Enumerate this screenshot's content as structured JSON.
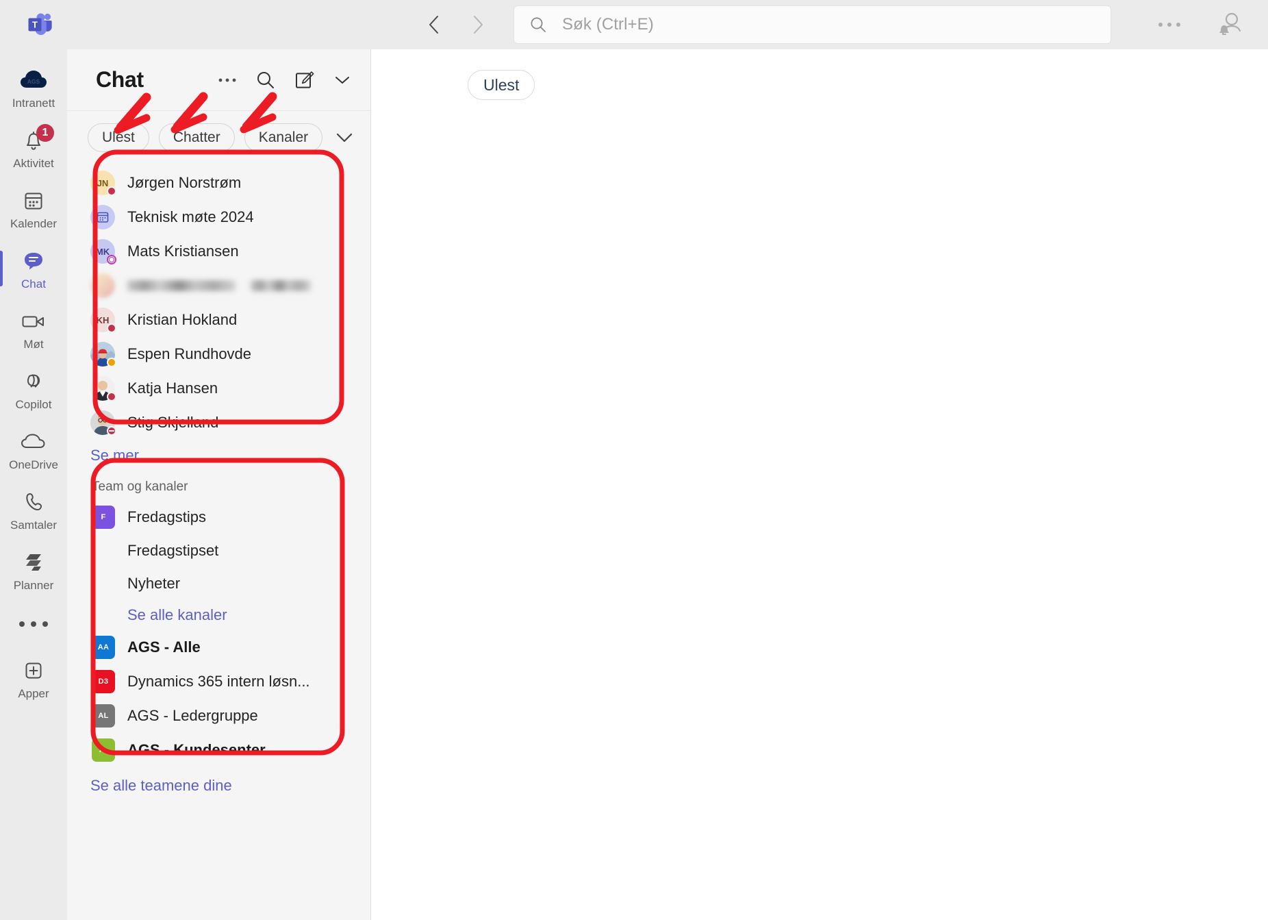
{
  "app": {
    "logo": "teams-logo"
  },
  "topbar": {
    "back_icon": "chevron-left-icon",
    "forward_icon": "chevron-right-icon",
    "search_icon": "search-icon",
    "search_placeholder": "Søk (Ctrl+E)",
    "more_icon": "ellipsis-icon",
    "account_icon": "account-bell-icon"
  },
  "rail": {
    "items": [
      {
        "label": "Intranett",
        "icon": "cloud-ags-icon",
        "badge": "",
        "active": false
      },
      {
        "label": "Aktivitet",
        "icon": "bell-icon",
        "badge": "1",
        "active": false
      },
      {
        "label": "Kalender",
        "icon": "calendar-icon",
        "badge": "",
        "active": false
      },
      {
        "label": "Chat",
        "icon": "chat-bubble-icon",
        "badge": "",
        "active": true
      },
      {
        "label": "Møt",
        "icon": "video-camera-icon",
        "badge": "",
        "active": false
      },
      {
        "label": "Copilot",
        "icon": "copilot-icon",
        "badge": "",
        "active": false
      },
      {
        "label": "OneDrive",
        "icon": "cloud-icon",
        "badge": "",
        "active": false
      },
      {
        "label": "Samtaler",
        "icon": "phone-icon",
        "badge": "",
        "active": false
      },
      {
        "label": "Planner",
        "icon": "planner-icon",
        "badge": "",
        "active": false
      }
    ],
    "more_icon": "ellipsis-icon",
    "apps": {
      "label": "Apper",
      "icon": "plus-square-icon"
    }
  },
  "pane": {
    "title": "Chat",
    "tools": [
      {
        "icon": "ellipsis-icon",
        "name": "more-options"
      },
      {
        "icon": "search-icon",
        "name": "search-chat"
      },
      {
        "icon": "compose-icon",
        "name": "new-chat"
      },
      {
        "icon": "chevron-down-icon",
        "name": "new-chat-dropdown"
      }
    ],
    "filters": [
      "Ulest",
      "Chatter",
      "Kanaler"
    ],
    "filter_expand_icon": "chevron-down-icon",
    "chats": [
      {
        "name": "Jørgen Norstrøm",
        "avatar_type": "initials",
        "initials": "JN",
        "avatar_bg": "#f8e3b0",
        "avatar_fg": "#7a5a10",
        "presence": "busy"
      },
      {
        "name": "Teknisk møte 2024",
        "avatar_type": "meeting",
        "initials": "",
        "avatar_bg": "#c5cbf5",
        "avatar_fg": "#4a4fc4",
        "presence": ""
      },
      {
        "name": "Mats Kristiansen",
        "avatar_type": "initials",
        "initials": "MK",
        "avatar_bg": "#c5c8f0",
        "avatar_fg": "#3b3b8f",
        "presence": "oof"
      },
      {
        "name": "",
        "avatar_type": "blurred",
        "initials": "",
        "avatar_bg": "",
        "avatar_fg": "",
        "presence": ""
      },
      {
        "name": "Kristian Hokland",
        "avatar_type": "initials",
        "initials": "KH",
        "avatar_bg": "#f2dcdc",
        "avatar_fg": "#6b3a3a",
        "presence": "busy"
      },
      {
        "name": "Espen Rundhovde",
        "avatar_type": "photo",
        "initials": "",
        "avatar_bg": "#8aa8c8",
        "avatar_fg": "",
        "presence": "away"
      },
      {
        "name": "Katja Hansen",
        "avatar_type": "photo",
        "initials": "",
        "avatar_bg": "#dcdcdc",
        "avatar_fg": "",
        "presence": "busy"
      },
      {
        "name": "Stig Skjelland",
        "avatar_type": "photo",
        "initials": "",
        "avatar_bg": "#b8b8b8",
        "avatar_fg": "",
        "presence": "dnd"
      }
    ],
    "see_more": "Se mer",
    "teams_section": {
      "label": "Team og kanaler",
      "team": {
        "name": "Fredagstips",
        "initials": "F",
        "color": "#7b52e0"
      },
      "channels": [
        "Fredagstipset",
        "Nyheter"
      ],
      "see_all_channels": "Se alle kanaler",
      "teams": [
        {
          "name": "AGS - Alle",
          "initials": "AA",
          "color": "#0f78d4",
          "unread": true
        },
        {
          "name": "Dynamics 365 intern løsn...",
          "initials": "D3",
          "color": "#e81123",
          "unread": false
        },
        {
          "name": "AGS - Ledergruppe",
          "initials": "AL",
          "color": "#767676",
          "unread": false
        },
        {
          "name": "AGS - Kundesenter",
          "initials": "A-",
          "color": "#8cbd32",
          "unread": true
        }
      ],
      "see_all_teams": "Se alle teamene dine"
    }
  },
  "main": {
    "unread_pill": "Ulest"
  },
  "annotations": {
    "color": "#ed1c24",
    "arrow_count": 3,
    "highlight_box_count": 2
  },
  "colors": {
    "accent": "#5b5fc7",
    "annotation_red": "#ed1c24",
    "badge_red": "#c4314b",
    "busy": "#c4314b",
    "away": "#eaa300",
    "oof": "#c239b3"
  }
}
